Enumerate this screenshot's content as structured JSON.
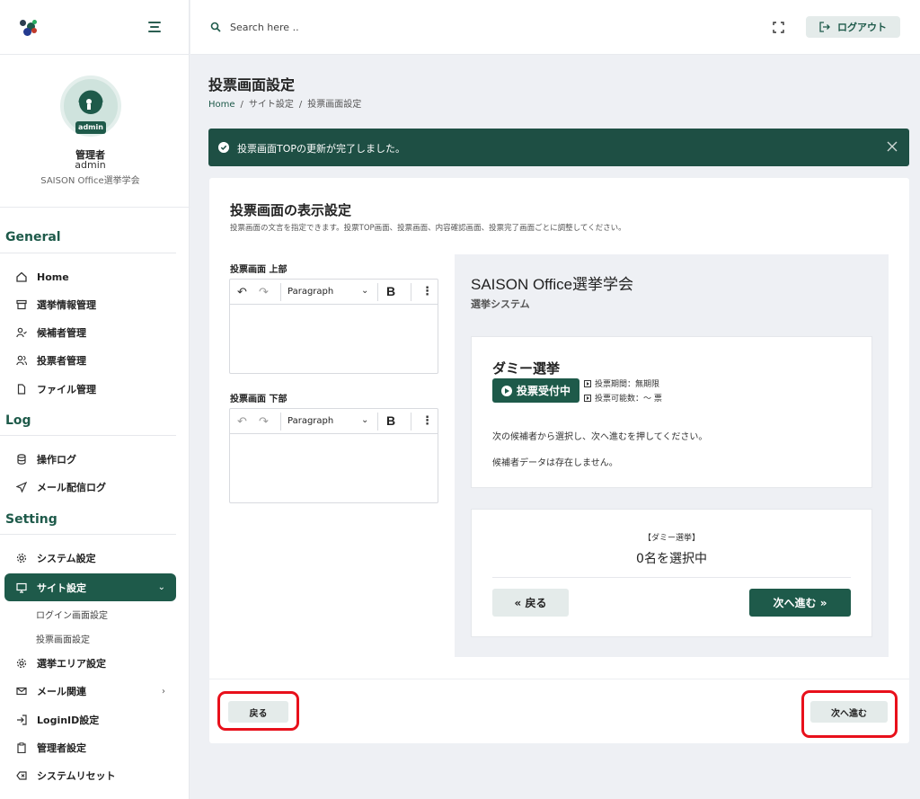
{
  "topbar": {
    "search_placeholder": "Search here ..",
    "logout_label": "ログアウト"
  },
  "profile": {
    "badge": "admin",
    "name": "管理者",
    "id": "admin",
    "org": "SAISON Office選挙学会"
  },
  "sidebar": {
    "sections": {
      "general": "General",
      "log": "Log",
      "setting": "Setting"
    },
    "general_items": [
      "Home",
      "選挙情報管理",
      "候補者管理",
      "投票者管理",
      "ファイル管理"
    ],
    "log_items": [
      "操作ログ",
      "メール配信ログ"
    ],
    "setting_items": [
      "システム設定",
      "サイト設定",
      "選挙エリア設定",
      "メール関連",
      "LoginID設定",
      "管理者設定",
      "システムリセット"
    ],
    "sub_items": [
      "ログイン画面設定",
      "投票画面設定"
    ]
  },
  "page": {
    "title": "投票画面設定",
    "breadcrumb": [
      "Home",
      "サイト設定",
      "投票画面設定"
    ]
  },
  "alert": {
    "message": "投票画面TOPの更新が完了しました。"
  },
  "card": {
    "title": "投票画面の表示設定",
    "description": "投票画面の文言を指定できます。投票TOP画面、投票画面、内容確認画面、投票完了画面ごとに調整してください。",
    "editor_top_label": "投票画面 上部",
    "editor_bottom_label": "投票画面 下部",
    "paragraph_label": "Paragraph",
    "bold_label": "B"
  },
  "preview": {
    "title": "SAISON Office選挙学会",
    "subtitle": "選挙システム",
    "election_name": "ダミー選挙",
    "status": "投票受付中",
    "period": "投票期間：無期限",
    "votable": "投票可能数：～ 票",
    "instruction": "次の候補者から選択し、次へ進むを押してください。",
    "no_candidates": "候補者データは存在しません。",
    "selection_election": "【ダミー選挙】",
    "selection_count": "0名を選択中",
    "back_label": "« 戻る",
    "next_label": "次へ進む »"
  },
  "footer": {
    "back_label": "戻る",
    "next_label": "次へ進む"
  },
  "colors": {
    "brand": "#1e5a4a",
    "alert_bg": "#1e4f44",
    "highlight": "#e8101b"
  }
}
